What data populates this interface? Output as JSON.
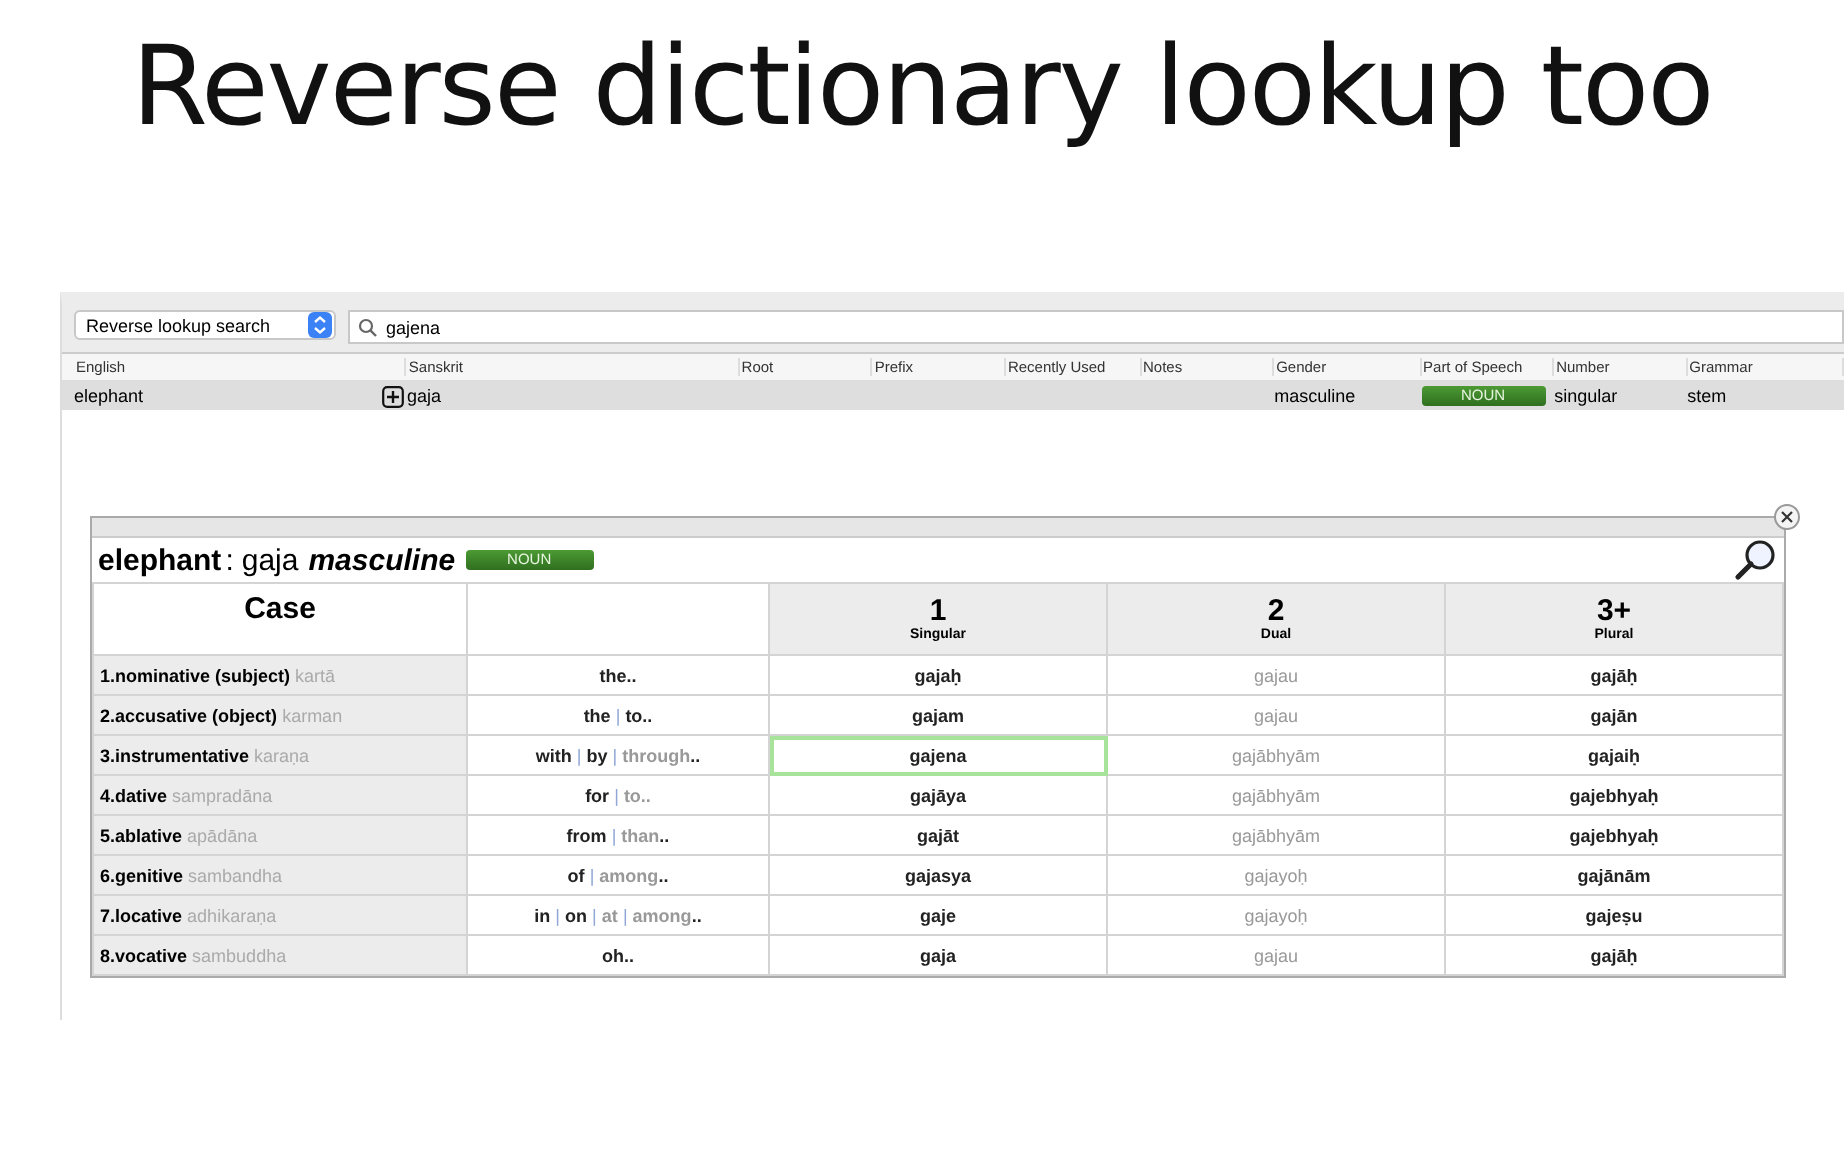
{
  "title": "Reverse dictionary lookup too",
  "search_mode": {
    "value": "Reverse lookup search"
  },
  "search": {
    "value": "gajena"
  },
  "results": {
    "columns": [
      "English",
      "Sanskrit",
      "Root",
      "Prefix",
      "Recently Used",
      "Notes",
      "Gender",
      "Part of Speech",
      "Number",
      "Grammar"
    ],
    "rows": [
      {
        "english": "elephant",
        "sanskrit": "gaja",
        "gender": "masculine",
        "part_of_speech": "NOUN",
        "number": "singular",
        "grammar": "stem",
        "selected": true
      }
    ]
  },
  "declension": {
    "english": "elephant",
    "separator": ":",
    "sanskrit": "gaja",
    "gender": "masculine",
    "part_of_speech": "NOUN",
    "case_header": "Case",
    "number_columns": [
      {
        "numeral": "1",
        "label": "Singular"
      },
      {
        "numeral": "2",
        "label": "Dual"
      },
      {
        "numeral": "3+",
        "label": "Plural"
      }
    ],
    "rows": [
      {
        "case": "1.nominative (subject)",
        "case_name": "kartā",
        "meaning": [
          {
            "text": "the..",
            "kind": "word"
          }
        ],
        "forms": [
          {
            "text": "gajaḥ",
            "muted": false,
            "selected": false
          },
          {
            "text": "gajau",
            "muted": true,
            "selected": false
          },
          {
            "text": "gajāḥ",
            "muted": false,
            "selected": false
          }
        ]
      },
      {
        "case": "2.accusative (object)",
        "case_name": "karman",
        "meaning": [
          {
            "text": "the",
            "kind": "word"
          },
          {
            "text": "|",
            "kind": "sep"
          },
          {
            "text": "to..",
            "kind": "word"
          }
        ],
        "forms": [
          {
            "text": "gajam",
            "muted": false,
            "selected": false
          },
          {
            "text": "gajau",
            "muted": true,
            "selected": false
          },
          {
            "text": "gajān",
            "muted": false,
            "selected": false
          }
        ]
      },
      {
        "case": "3.instrumentative",
        "case_name": "karaṇa",
        "meaning": [
          {
            "text": "with",
            "kind": "word"
          },
          {
            "text": "|",
            "kind": "sep"
          },
          {
            "text": "by",
            "kind": "word"
          },
          {
            "text": "|",
            "kind": "sep"
          },
          {
            "text": "through",
            "kind": "muted"
          },
          {
            "text": "..",
            "kind": "word"
          }
        ],
        "forms": [
          {
            "text": "gajena",
            "muted": false,
            "selected": true
          },
          {
            "text": "gajābhyām",
            "muted": true,
            "selected": false
          },
          {
            "text": "gajaiḥ",
            "muted": false,
            "selected": false
          }
        ]
      },
      {
        "case": "4.dative",
        "case_name": "sampradāna",
        "meaning": [
          {
            "text": "for",
            "kind": "word"
          },
          {
            "text": "|",
            "kind": "sep"
          },
          {
            "text": "to..",
            "kind": "muted"
          }
        ],
        "forms": [
          {
            "text": "gajāya",
            "muted": false,
            "selected": false
          },
          {
            "text": "gajābhyām",
            "muted": true,
            "selected": false
          },
          {
            "text": "gajebhyaḥ",
            "muted": false,
            "selected": false
          }
        ]
      },
      {
        "case": "5.ablative",
        "case_name": "apādāna",
        "meaning": [
          {
            "text": "from",
            "kind": "word"
          },
          {
            "text": "|",
            "kind": "sep"
          },
          {
            "text": "than",
            "kind": "muted"
          },
          {
            "text": "..",
            "kind": "word"
          }
        ],
        "forms": [
          {
            "text": "gajāt",
            "muted": false,
            "selected": false
          },
          {
            "text": "gajābhyām",
            "muted": true,
            "selected": false
          },
          {
            "text": "gajebhyaḥ",
            "muted": false,
            "selected": false
          }
        ]
      },
      {
        "case": "6.genitive",
        "case_name": "sambandha",
        "meaning": [
          {
            "text": "of",
            "kind": "word"
          },
          {
            "text": "|",
            "kind": "sep"
          },
          {
            "text": "among",
            "kind": "muted"
          },
          {
            "text": "..",
            "kind": "word"
          }
        ],
        "forms": [
          {
            "text": "gajasya",
            "muted": false,
            "selected": false
          },
          {
            "text": "gajayoḥ",
            "muted": true,
            "selected": false
          },
          {
            "text": "gajānām",
            "muted": false,
            "selected": false
          }
        ]
      },
      {
        "case": "7.locative",
        "case_name": "adhikaraṇa",
        "meaning": [
          {
            "text": "in",
            "kind": "word"
          },
          {
            "text": "|",
            "kind": "sep"
          },
          {
            "text": "on",
            "kind": "word"
          },
          {
            "text": "|",
            "kind": "sep"
          },
          {
            "text": "at",
            "kind": "muted"
          },
          {
            "text": "|",
            "kind": "sep"
          },
          {
            "text": "among",
            "kind": "muted"
          },
          {
            "text": "..",
            "kind": "word"
          }
        ],
        "forms": [
          {
            "text": "gaje",
            "muted": false,
            "selected": false
          },
          {
            "text": "gajayoḥ",
            "muted": true,
            "selected": false
          },
          {
            "text": "gajeṣu",
            "muted": false,
            "selected": false
          }
        ]
      },
      {
        "case": "8.vocative",
        "case_name": "sambuddha",
        "meaning": [
          {
            "text": "oh..",
            "kind": "word"
          }
        ],
        "forms": [
          {
            "text": "gaja",
            "muted": false,
            "selected": false
          },
          {
            "text": "gajau",
            "muted": true,
            "selected": false
          },
          {
            "text": "gajāḥ",
            "muted": false,
            "selected": false
          }
        ]
      }
    ]
  }
}
